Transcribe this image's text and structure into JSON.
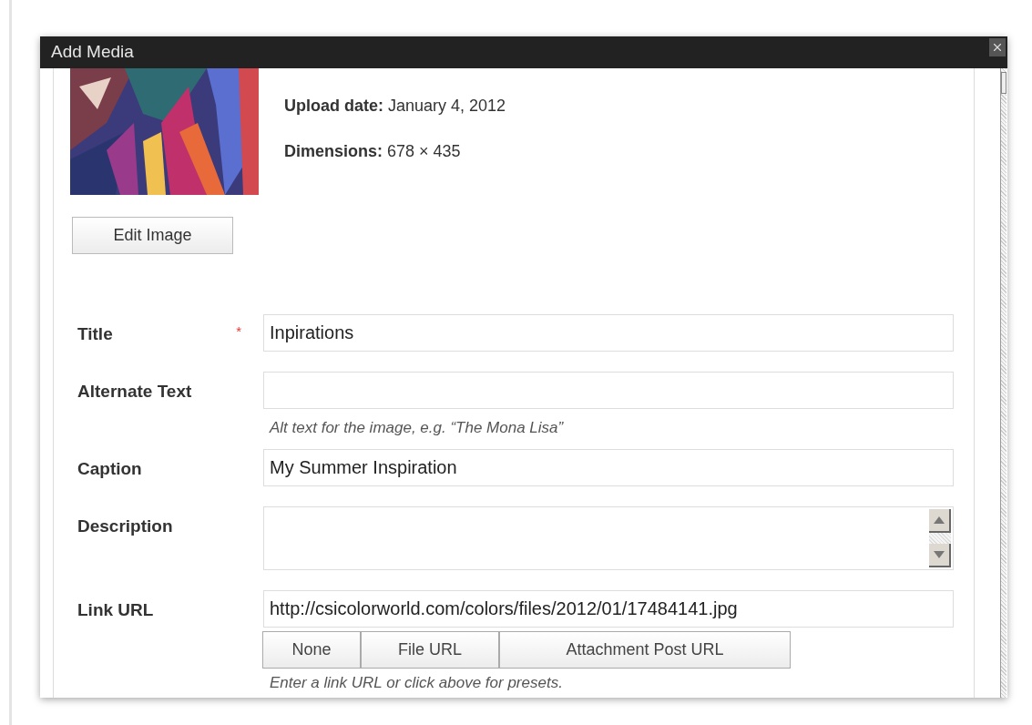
{
  "dialog": {
    "title": "Add Media"
  },
  "meta": [
    {
      "label": "Upload date:",
      "value": "January 4, 2012"
    },
    {
      "label": "Dimensions:",
      "value": "678 × 435"
    }
  ],
  "edit_button": "Edit Image",
  "fields": [
    {
      "label": "Title",
      "required": true,
      "kind": "input",
      "value": "Inpirations"
    },
    {
      "label": "Alternate Text",
      "required": false,
      "kind": "input",
      "help": "Alt text for the image, e.g. “The Mona Lisa”"
    },
    {
      "label": "Caption",
      "required": false,
      "kind": "input",
      "value": "My Summer Inspiration"
    },
    {
      "label": "Description",
      "required": false,
      "kind": "textarea"
    },
    {
      "label": "Link URL",
      "required": false,
      "kind": "input",
      "value": "http://csicolorworld.com/colors/files/2012/01/17484141.jpg",
      "buttons": [
        "None",
        "File URL",
        "Attachment Post URL"
      ],
      "help": "Enter a link URL or click above for presets."
    }
  ],
  "required_mark": "*"
}
